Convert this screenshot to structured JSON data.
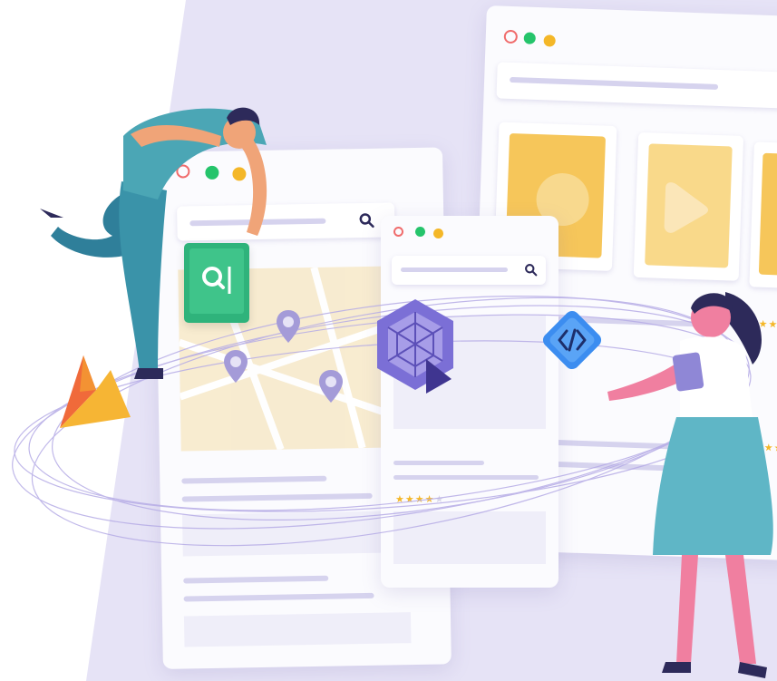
{
  "scene": {
    "stars_large": "★★★★★",
    "stars_small": "★★★★",
    "star_empty": "★"
  },
  "colors": {
    "background": "#e6e3f6",
    "window": "#fbfbfe",
    "window_bar": "#d6d3ee",
    "dot_red": "#f06b6b",
    "dot_green": "#25c46b",
    "dot_yellow": "#f4b728",
    "search_badge": "#2fb37b",
    "code_badge": "#3c8df0",
    "cube_badge": "#7b6fd6",
    "mountain_logo": "#f08b2a",
    "card_yellow": "#f6c65a",
    "map_tint": "#f7e9c8",
    "orbit_lines": "#b6ace6",
    "skirt": "#5fb6c6",
    "skin": "#f07fa0",
    "man_shirt": "#4ba6b5",
    "hair": "#2d2a5a"
  },
  "icons": [
    "search-icon",
    "code-brackets-icon",
    "cube-play-icon",
    "mountain-logo-icon",
    "map-pin-icon",
    "tablet-icon"
  ]
}
